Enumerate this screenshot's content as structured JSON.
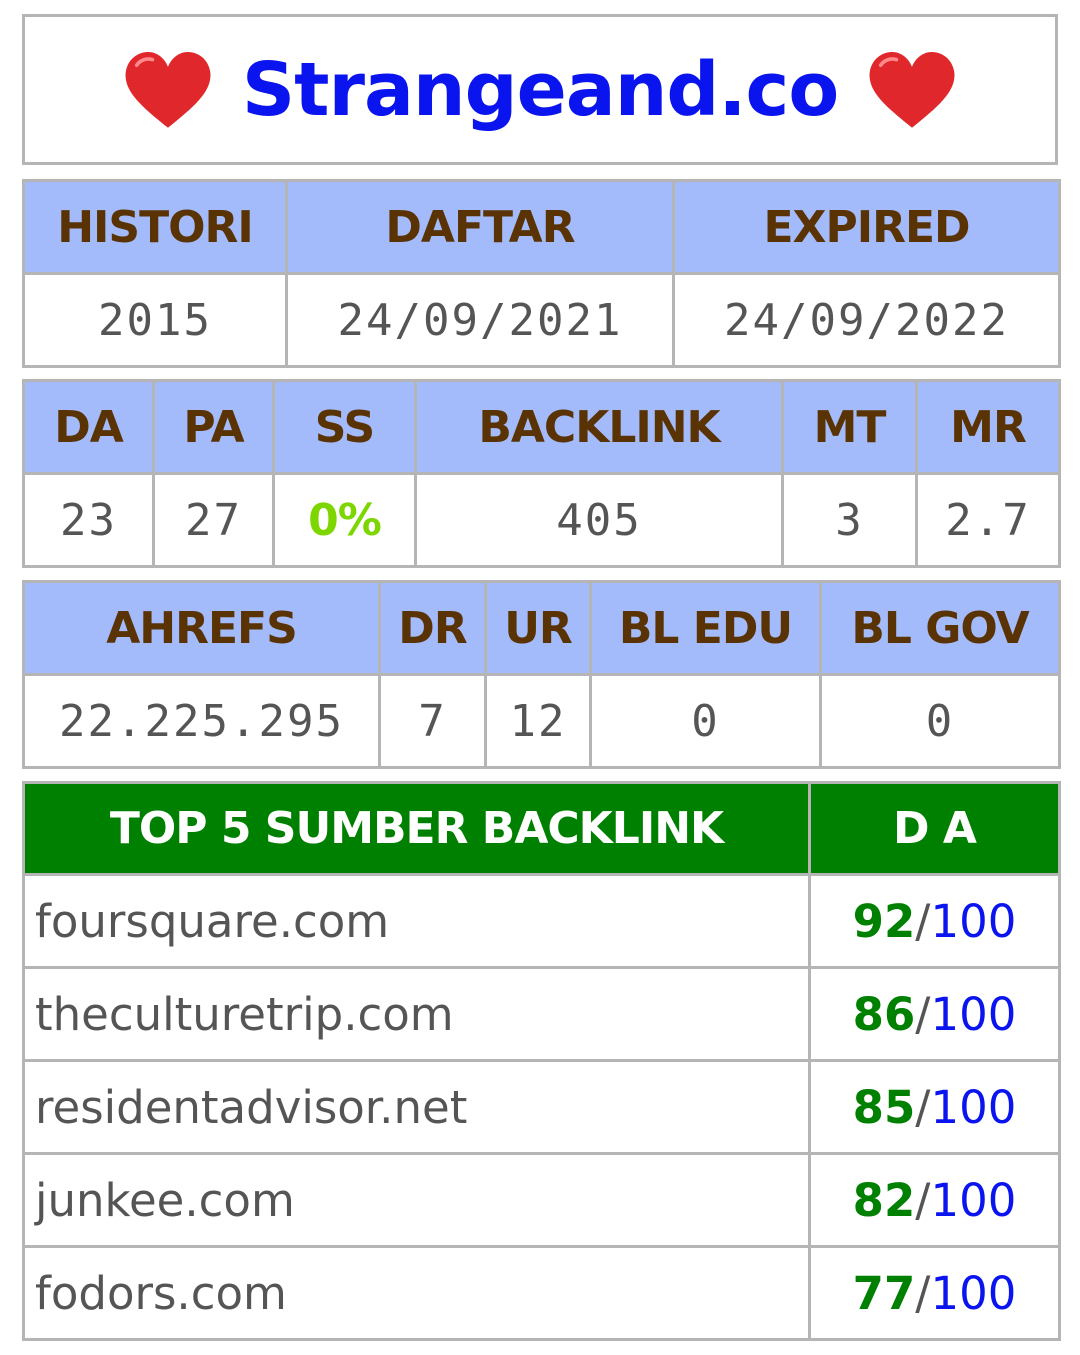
{
  "header": {
    "site": "Strangeand.co",
    "left_icon": "heart-icon",
    "right_icon": "heart-icon",
    "heart_color": "#e0282c"
  },
  "colors": {
    "header_bg": "#a4bbfb",
    "header_text": "#5a3305",
    "top_header_bg": "#008000",
    "title": "#0a14ee",
    "ss_value": "#7ed600",
    "score_value": "#008000",
    "score_max": "#0a14ee"
  },
  "history_table": {
    "headers": [
      "HISTORI",
      "DAFTAR",
      "EXPIRED"
    ],
    "values": [
      "2015",
      "24/09/2021",
      "24/09/2022"
    ]
  },
  "metrics_table": {
    "headers": [
      "DA",
      "PA",
      "SS",
      "BACKLINK",
      "MT",
      "MR"
    ],
    "values": [
      "23",
      "27",
      "0%",
      "405",
      "3",
      "2.7"
    ]
  },
  "ahrefs_table": {
    "headers": [
      "AHREFS",
      "DR",
      "UR",
      "BL EDU",
      "BL GOV"
    ],
    "values": [
      "22.225.295",
      "7",
      "12",
      "0",
      "0"
    ]
  },
  "top_backlinks": {
    "headers": [
      "TOP 5 SUMBER BACKLINK",
      "D A"
    ],
    "rows": [
      {
        "domain": "foursquare.com",
        "score": "92",
        "slash": "/",
        "max": "100"
      },
      {
        "domain": "theculturetrip.com",
        "score": "86",
        "slash": "/",
        "max": "100"
      },
      {
        "domain": "residentadvisor.net",
        "score": "85",
        "slash": "/",
        "max": "100"
      },
      {
        "domain": "junkee.com",
        "score": "82",
        "slash": "/",
        "max": "100"
      },
      {
        "domain": "fodors.com",
        "score": "77",
        "slash": "/",
        "max": "100"
      }
    ]
  }
}
